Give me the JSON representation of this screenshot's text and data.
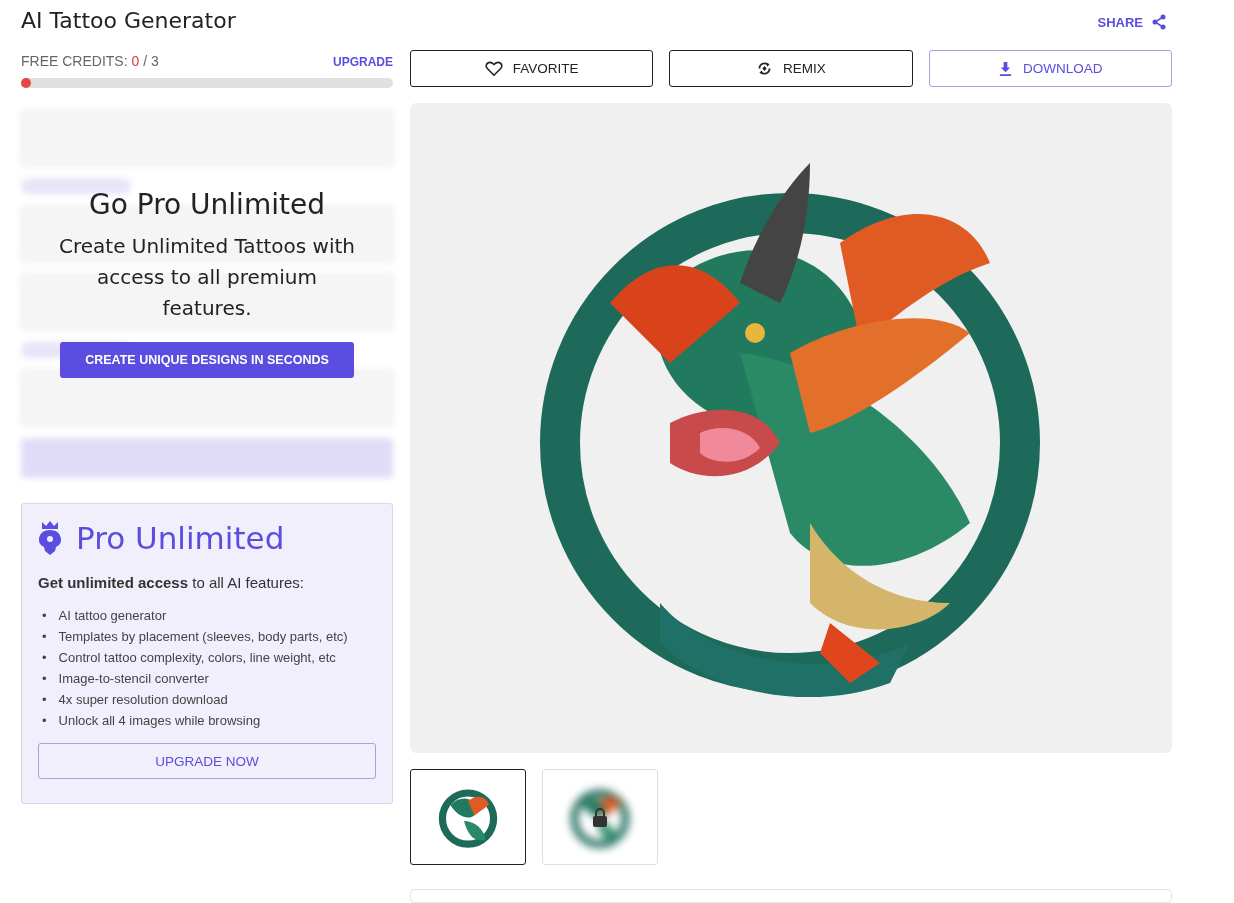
{
  "header": {
    "title": "AI Tattoo Generator",
    "share": "SHARE"
  },
  "credits": {
    "label": "FREE CREDITS:",
    "used": "0",
    "total": "/ 3",
    "upgrade": "UPGRADE",
    "level": 0
  },
  "overlay": {
    "title": "Go Pro Unlimited",
    "text": "Create Unlimited Tattoos with access to all premium features.",
    "button": "CREATE UNIQUE DESIGNS IN SECONDS"
  },
  "pro": {
    "title": "Pro Unlimited",
    "intro": "**Get unlimited access** to all AI features:",
    "features": [
      {
        "bullet": "•",
        "text": "AI tattoo generator"
      },
      {
        "bullet": "•",
        "text": "Templates by placement (sleeves, body parts, etc)"
      },
      {
        "bullet": "•",
        "text": "Control tattoo complexity, colors, line weight, etc"
      },
      {
        "bullet": "•",
        "text": "Image-to-stencil converter"
      },
      {
        "bullet": "•",
        "text": "4x super resolution download"
      },
      {
        "bullet": "•",
        "text": "Unlock all 4 images while browsing"
      }
    ],
    "button": "UPGRADE NOW"
  },
  "actions": [
    {
      "kind": "favorite",
      "label": "FAVORITE"
    },
    {
      "kind": "remix",
      "label": "REMIX"
    },
    {
      "kind": "download",
      "label": "DOWNLOAD"
    }
  ],
  "thumbnails": [
    {
      "selected": true,
      "locked": false
    },
    {
      "selected": false,
      "locked": true
    }
  ]
}
